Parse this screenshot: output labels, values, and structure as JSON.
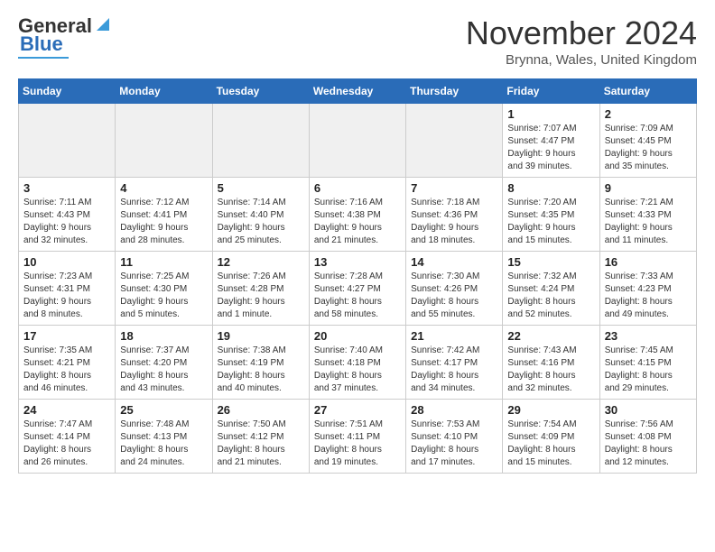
{
  "header": {
    "logo_general": "General",
    "logo_blue": "Blue",
    "month": "November 2024",
    "location": "Brynna, Wales, United Kingdom"
  },
  "days_of_week": [
    "Sunday",
    "Monday",
    "Tuesday",
    "Wednesday",
    "Thursday",
    "Friday",
    "Saturday"
  ],
  "weeks": [
    [
      {
        "day": "",
        "info": "",
        "empty": true
      },
      {
        "day": "",
        "info": "",
        "empty": true
      },
      {
        "day": "",
        "info": "",
        "empty": true
      },
      {
        "day": "",
        "info": "",
        "empty": true
      },
      {
        "day": "",
        "info": "",
        "empty": true
      },
      {
        "day": "1",
        "info": "Sunrise: 7:07 AM\nSunset: 4:47 PM\nDaylight: 9 hours\nand 39 minutes."
      },
      {
        "day": "2",
        "info": "Sunrise: 7:09 AM\nSunset: 4:45 PM\nDaylight: 9 hours\nand 35 minutes."
      }
    ],
    [
      {
        "day": "3",
        "info": "Sunrise: 7:11 AM\nSunset: 4:43 PM\nDaylight: 9 hours\nand 32 minutes."
      },
      {
        "day": "4",
        "info": "Sunrise: 7:12 AM\nSunset: 4:41 PM\nDaylight: 9 hours\nand 28 minutes."
      },
      {
        "day": "5",
        "info": "Sunrise: 7:14 AM\nSunset: 4:40 PM\nDaylight: 9 hours\nand 25 minutes."
      },
      {
        "day": "6",
        "info": "Sunrise: 7:16 AM\nSunset: 4:38 PM\nDaylight: 9 hours\nand 21 minutes."
      },
      {
        "day": "7",
        "info": "Sunrise: 7:18 AM\nSunset: 4:36 PM\nDaylight: 9 hours\nand 18 minutes."
      },
      {
        "day": "8",
        "info": "Sunrise: 7:20 AM\nSunset: 4:35 PM\nDaylight: 9 hours\nand 15 minutes."
      },
      {
        "day": "9",
        "info": "Sunrise: 7:21 AM\nSunset: 4:33 PM\nDaylight: 9 hours\nand 11 minutes."
      }
    ],
    [
      {
        "day": "10",
        "info": "Sunrise: 7:23 AM\nSunset: 4:31 PM\nDaylight: 9 hours\nand 8 minutes."
      },
      {
        "day": "11",
        "info": "Sunrise: 7:25 AM\nSunset: 4:30 PM\nDaylight: 9 hours\nand 5 minutes."
      },
      {
        "day": "12",
        "info": "Sunrise: 7:26 AM\nSunset: 4:28 PM\nDaylight: 9 hours\nand 1 minute."
      },
      {
        "day": "13",
        "info": "Sunrise: 7:28 AM\nSunset: 4:27 PM\nDaylight: 8 hours\nand 58 minutes."
      },
      {
        "day": "14",
        "info": "Sunrise: 7:30 AM\nSunset: 4:26 PM\nDaylight: 8 hours\nand 55 minutes."
      },
      {
        "day": "15",
        "info": "Sunrise: 7:32 AM\nSunset: 4:24 PM\nDaylight: 8 hours\nand 52 minutes."
      },
      {
        "day": "16",
        "info": "Sunrise: 7:33 AM\nSunset: 4:23 PM\nDaylight: 8 hours\nand 49 minutes."
      }
    ],
    [
      {
        "day": "17",
        "info": "Sunrise: 7:35 AM\nSunset: 4:21 PM\nDaylight: 8 hours\nand 46 minutes."
      },
      {
        "day": "18",
        "info": "Sunrise: 7:37 AM\nSunset: 4:20 PM\nDaylight: 8 hours\nand 43 minutes."
      },
      {
        "day": "19",
        "info": "Sunrise: 7:38 AM\nSunset: 4:19 PM\nDaylight: 8 hours\nand 40 minutes."
      },
      {
        "day": "20",
        "info": "Sunrise: 7:40 AM\nSunset: 4:18 PM\nDaylight: 8 hours\nand 37 minutes."
      },
      {
        "day": "21",
        "info": "Sunrise: 7:42 AM\nSunset: 4:17 PM\nDaylight: 8 hours\nand 34 minutes."
      },
      {
        "day": "22",
        "info": "Sunrise: 7:43 AM\nSunset: 4:16 PM\nDaylight: 8 hours\nand 32 minutes."
      },
      {
        "day": "23",
        "info": "Sunrise: 7:45 AM\nSunset: 4:15 PM\nDaylight: 8 hours\nand 29 minutes."
      }
    ],
    [
      {
        "day": "24",
        "info": "Sunrise: 7:47 AM\nSunset: 4:14 PM\nDaylight: 8 hours\nand 26 minutes."
      },
      {
        "day": "25",
        "info": "Sunrise: 7:48 AM\nSunset: 4:13 PM\nDaylight: 8 hours\nand 24 minutes."
      },
      {
        "day": "26",
        "info": "Sunrise: 7:50 AM\nSunset: 4:12 PM\nDaylight: 8 hours\nand 21 minutes."
      },
      {
        "day": "27",
        "info": "Sunrise: 7:51 AM\nSunset: 4:11 PM\nDaylight: 8 hours\nand 19 minutes."
      },
      {
        "day": "28",
        "info": "Sunrise: 7:53 AM\nSunset: 4:10 PM\nDaylight: 8 hours\nand 17 minutes."
      },
      {
        "day": "29",
        "info": "Sunrise: 7:54 AM\nSunset: 4:09 PM\nDaylight: 8 hours\nand 15 minutes."
      },
      {
        "day": "30",
        "info": "Sunrise: 7:56 AM\nSunset: 4:08 PM\nDaylight: 8 hours\nand 12 minutes."
      }
    ]
  ]
}
